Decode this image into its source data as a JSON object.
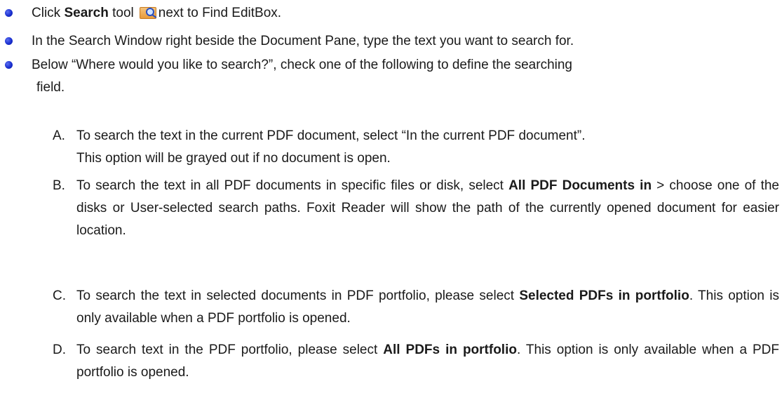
{
  "bullets": [
    {
      "pre": "Click ",
      "bold": "Search",
      "mid": " tool",
      "post": "next to Find EditBox."
    },
    {
      "text": "In the Search Window right beside the Document Pane, type the text you want to search for."
    },
    {
      "line1": "Below “Where would you like to search?”, check one of the following to define the searching",
      "line2": "field."
    }
  ],
  "options": [
    {
      "letter": "A.",
      "line1": "To search the text in the current PDF document, select “In the current PDF document”.",
      "line2": "This option will be grayed out if no document is open."
    },
    {
      "letter": "B.",
      "pre": "To search the text in all PDF documents in specific files or disk, select ",
      "bold": "All PDF Documents in",
      "post": " > choose one of the disks or User-selected search paths. Foxit Reader will show the path of the currently opened document for easier location."
    },
    {
      "letter": "C.",
      "pre": "To search the text in selected documents in PDF portfolio, please select ",
      "bold": "Selected PDFs in portfolio",
      "post": ". This option is only available when a PDF portfolio is opened."
    },
    {
      "letter": "D.",
      "pre": "To search text in the PDF portfolio, please select ",
      "bold": "All PDFs in portfolio",
      "post": ". This option is only available when a PDF portfolio is opened."
    }
  ],
  "icons": {
    "bullet": "bullet-dot-icon",
    "search_tool": "folder-search-icon"
  }
}
